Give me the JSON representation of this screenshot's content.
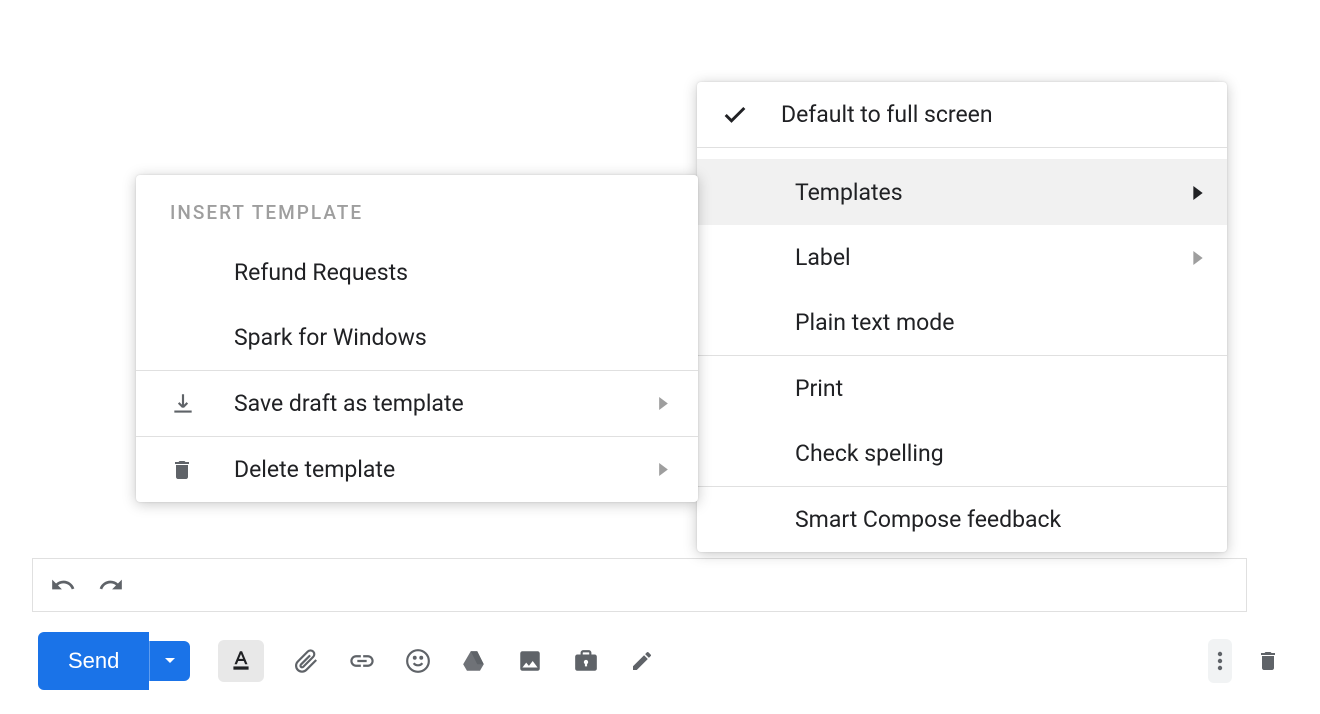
{
  "toolbar": {
    "send_label": "Send"
  },
  "main_menu": {
    "fullscreen": "Default to full screen",
    "templates": "Templates",
    "label": "Label",
    "plain_text": "Plain text mode",
    "print": "Print",
    "check_spelling": "Check spelling",
    "smart_compose": "Smart Compose feedback"
  },
  "sub_menu": {
    "header": "INSERT TEMPLATE",
    "items": [
      "Refund Requests",
      "Spark for Windows"
    ],
    "save_draft": "Save draft as template",
    "delete_template": "Delete template"
  }
}
